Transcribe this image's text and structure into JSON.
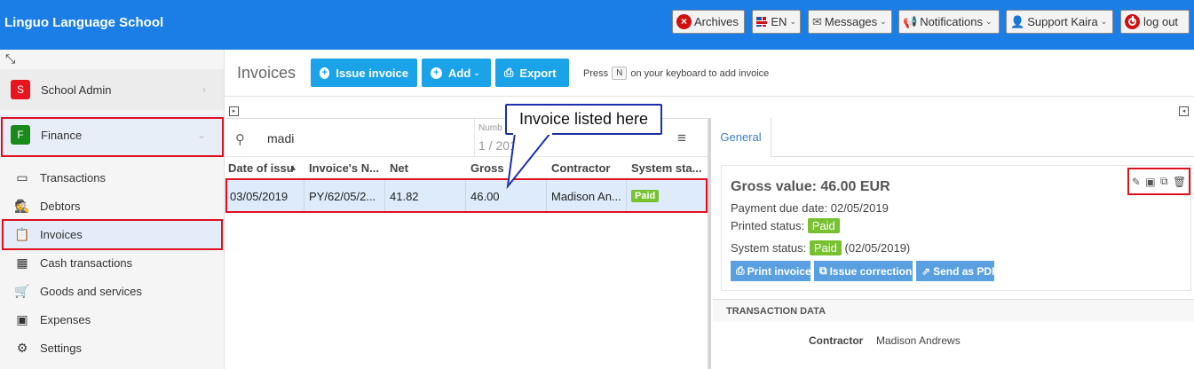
{
  "header": {
    "brand": "Linguo Language School",
    "archives": "Archives",
    "language": "EN",
    "messages": "Messages",
    "notifications": "Notifications",
    "user": "Support Kaira",
    "logout": "log out"
  },
  "sidebar": {
    "modules": [
      {
        "badge": "S",
        "label": "School Admin",
        "color": "#e8141e"
      },
      {
        "badge": "F",
        "label": "Finance",
        "color": "#1a8a1a"
      }
    ],
    "items": [
      {
        "label": "Transactions",
        "icon": "credit-card-icon"
      },
      {
        "label": "Debtors",
        "icon": "debtor-icon"
      },
      {
        "label": "Invoices",
        "icon": "clipboard-icon"
      },
      {
        "label": "Cash transactions",
        "icon": "calendar-icon"
      },
      {
        "label": "Goods and services",
        "icon": "cart-icon"
      },
      {
        "label": "Expenses",
        "icon": "wallet-icon"
      },
      {
        "label": "Settings",
        "icon": "gear-icon"
      }
    ]
  },
  "main": {
    "title": "Invoices",
    "issue_invoice": "Issue invoice",
    "add": "Add",
    "export": "Export",
    "press_prefix": "Press",
    "press_key": "N",
    "press_suffix": "on your keyboard to add invoice"
  },
  "list": {
    "search_value": "madi",
    "number_label": "Numb",
    "number_value": "1 / 201",
    "columns": [
      "Date of issu",
      "Invoice's N...",
      "Net",
      "Gross",
      "Contractor",
      "System sta..."
    ],
    "rows": [
      {
        "date": "03/05/2019",
        "number": "PY/62/05/2...",
        "net": "41.82",
        "gross": "46.00",
        "contractor": "Madison An...",
        "status": "Paid"
      }
    ]
  },
  "callout": "Invoice listed here",
  "detail": {
    "tab": "General",
    "gross": "Gross value: 46.00 EUR",
    "due_label": "Payment due date: 02/05/2019",
    "printed_label": "Printed status:",
    "printed_value": "Paid",
    "system_label": "System status:",
    "system_value": "Paid",
    "system_date": "(02/05/2019)",
    "print_invoice": "Print invoice",
    "issue_correction": "Issue correction",
    "send_pdf": "Send as PDF",
    "section": "TRANSACTION DATA",
    "contractor_label": "Contractor",
    "contractor_value": "Madison Andrews"
  }
}
